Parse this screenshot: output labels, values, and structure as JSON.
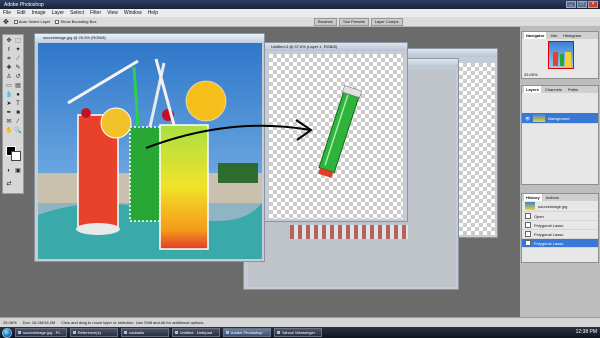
{
  "app": {
    "title": "Adobe Photoshop"
  },
  "menu": [
    "File",
    "Edit",
    "Image",
    "Layer",
    "Select",
    "Filter",
    "View",
    "Window",
    "Help"
  ],
  "options": {
    "auto_select": "Auto Select Layer",
    "bounding": "Show Bounding Box"
  },
  "palette_well": [
    "Brushes",
    "Tool Presets",
    "Layer Comps"
  ],
  "docs": {
    "source": {
      "title": "sourceimage.jpg @ 25.5% (RGB/8)"
    },
    "untitled": {
      "title": "Untitled-3 @ 37.6% (Layer 1, RGB/8)"
    }
  },
  "navigator": {
    "tabs": [
      "Navigator",
      "Info",
      "Histogram"
    ],
    "zoom": "25.06%"
  },
  "layers": {
    "tabs": [
      "Layers",
      "Channels",
      "Paths"
    ],
    "layer_name": "Background"
  },
  "history": {
    "tabs": [
      "History",
      "Actions"
    ],
    "snapshot": "sourceimage.jpg",
    "items": [
      "Open",
      "Polygonal Lasso",
      "Polygonal Lasso",
      "Polygonal Lasso"
    ]
  },
  "status": {
    "zoom": "25.06%",
    "doc": "Doc: 16.2M/16.2M",
    "hint": "Click and drag to move layer or selection. Use Shift and Alt for additional options."
  },
  "taskbar": {
    "items": [
      "sourceimage.jpg - Pi...",
      "Reference(s)",
      "cocktails",
      "Untitled - Notepad",
      "Adobe Photoshop",
      "Yahoo! Messenger"
    ],
    "time": "12:38 PM"
  },
  "colors": {
    "accent": "#3a78d6",
    "title": "#162238"
  }
}
